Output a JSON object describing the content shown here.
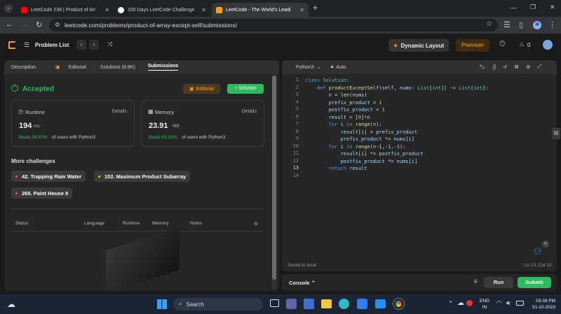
{
  "browser": {
    "tabs": [
      {
        "title": "LeetCode 238 | Product of Arr",
        "color": "#ff0000"
      },
      {
        "title": "100 Days LeetCode Challenge",
        "color": "#ffffff"
      },
      {
        "title": "LeetCode - The World's Leadi",
        "color": "#ffa116"
      }
    ],
    "new_tab": "+",
    "url": "leetcode.com/problems/product-of-array-except-self/submissions/",
    "profile_initial": "H"
  },
  "header": {
    "problem_list": "Problem List",
    "dynamic_layout": "Dynamic Layout",
    "premium": "Premium",
    "streak": "0"
  },
  "left": {
    "tabs": [
      "Description",
      "Editorial",
      "Solutions (8.8K)",
      "Submissions"
    ],
    "status": "Accepted",
    "editorial_btn": "Editorial",
    "solution_btn": "+ Solution",
    "runtime": {
      "label": "Runtime",
      "details": "Details",
      "value": "194",
      "unit": "ms",
      "beats": "Beats 58.81%",
      "suffix": "of users with Python3"
    },
    "memory": {
      "label": "Memory",
      "details": "Details",
      "value": "23.91",
      "unit": "MB",
      "beats": "Beats 63.31%",
      "suffix": "of users with Python3"
    },
    "more_title": "More challenges",
    "challenges": [
      "42. Trapping Rain Water",
      "152. Maximum Product Subarray",
      "265. Paint House II"
    ],
    "table_headers": [
      "Status",
      "Language",
      "Runtime",
      "Memory",
      "Notes"
    ]
  },
  "editor": {
    "language": "Python3",
    "mode": "Auto",
    "lines": [
      "1",
      "2",
      "3",
      "4",
      "5",
      "6",
      "7",
      "8",
      "9",
      "10",
      "11",
      "12",
      "13",
      "14"
    ],
    "saved": "Saved to local",
    "cursor": "Ln 13, Col 22",
    "console": "Console",
    "run": "Run",
    "submit": "Submit"
  },
  "taskbar": {
    "search": "Search",
    "lang_top": "ENG",
    "lang_bottom": "IN",
    "time": "03:38 PM",
    "date": "31-10-2023"
  },
  "colors": {
    "accent": "#ffa116",
    "green": "#2cbb5d",
    "bg": "#1a1a1a"
  }
}
